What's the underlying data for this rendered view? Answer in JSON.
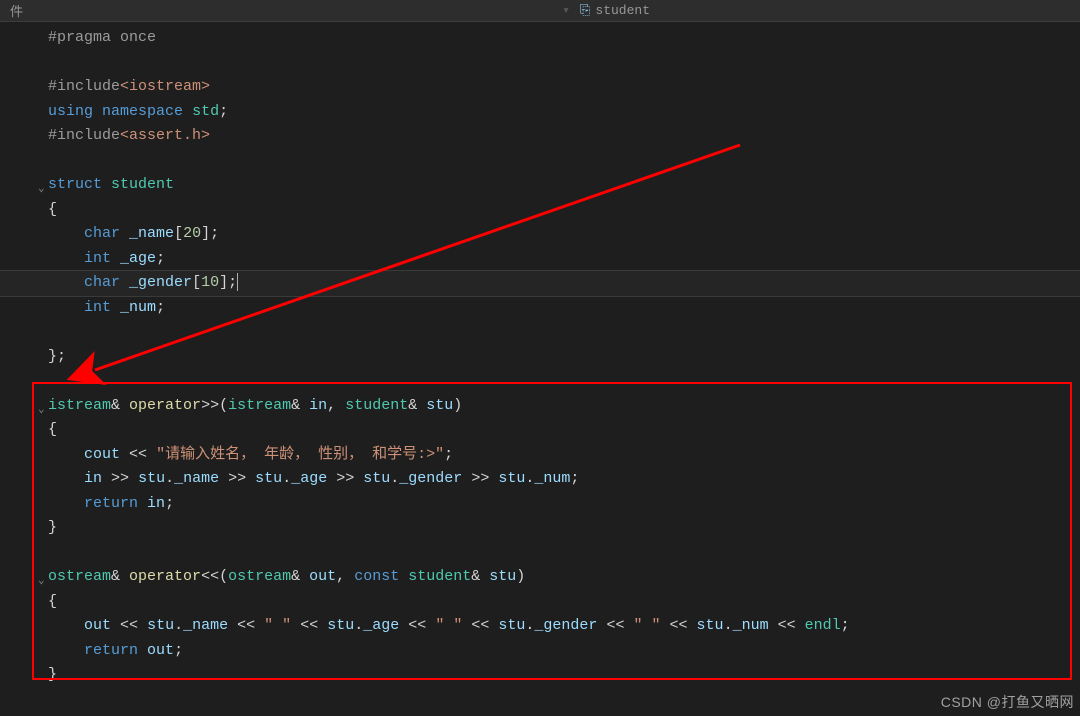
{
  "titlebar": {
    "left": "件",
    "right_icon": "⎘",
    "right_label": "student"
  },
  "code": {
    "pragma": "#pragma once",
    "inc1_a": "#include",
    "inc1_b": "<iostream>",
    "using_a": "using",
    "using_b": "namespace",
    "using_c": "std",
    "inc2_a": "#include",
    "inc2_b": "<assert.h>",
    "struct_kw": "struct",
    "struct_name": "student",
    "char": "char",
    "int": "int",
    "name_field": "_name",
    "name_size": "20",
    "age_field": "_age",
    "gender_field": "_gender",
    "gender_size": "10",
    "num_field": "_num",
    "istream": "istream",
    "ostream": "ostream",
    "operator": "operator",
    "shr": ">>",
    "shl": "<<",
    "in": "in",
    "out": "out",
    "stu": "stu",
    "const": "const",
    "cout": "cout",
    "endl": "endl",
    "prompt": "\"请输入姓名， 年龄， 性别， 和学号:>\"",
    "space": "\" \"",
    "return": "return",
    "amp": "&",
    "lp": "(",
    "rp": ")",
    "lb": "{",
    "rb": "}",
    "lbk": "[",
    "rbk": "]",
    "semi": ";",
    "comma": ",",
    "dot": "."
  },
  "watermark": "CSDN @打鱼又晒网"
}
